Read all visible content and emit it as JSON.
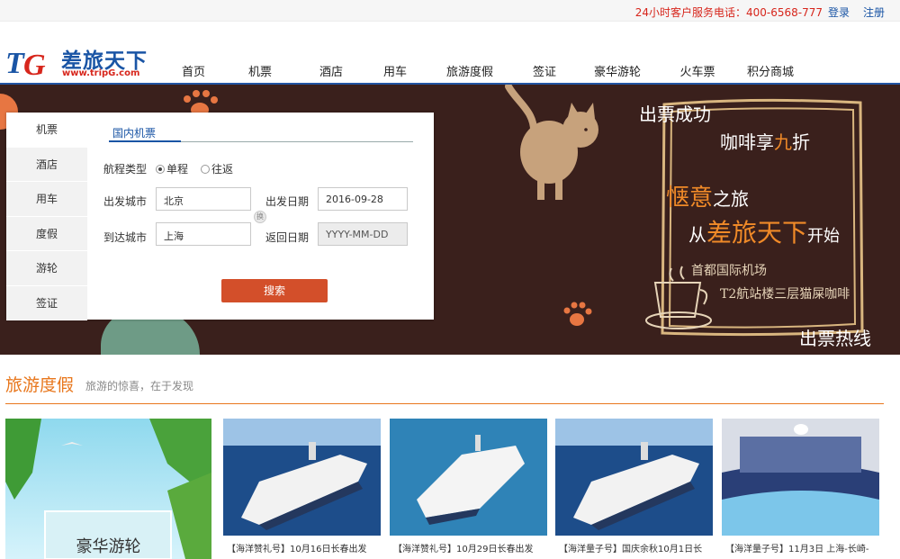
{
  "topbar": {
    "hotline": "24小时客户服务电话：400-6568-777",
    "login": "登录",
    "register": "注册"
  },
  "logo": {
    "mark": "TG",
    "brand": "差旅天下",
    "url": "www.tripG.com"
  },
  "nav": [
    "首页",
    "机票",
    "酒店",
    "用车",
    "旅游度假",
    "签证",
    "豪华游轮",
    "火车票",
    "积分商城"
  ],
  "booking": {
    "side_tabs": [
      "机票",
      "酒店",
      "用车",
      "度假",
      "游轮",
      "签证"
    ],
    "tab": "国内机票",
    "trip_type_label": "航程类型",
    "one_way": "单程",
    "round_trip": "往返",
    "depart_city_label": "出发城市",
    "depart_city": "北京",
    "arrive_city_label": "到达城市",
    "arrive_city": "上海",
    "swap": "换",
    "depart_date_label": "出发日期",
    "depart_date": "2016-09-28",
    "return_date_label": "返回日期",
    "return_date": "YYYY-MM-DD",
    "search": "搜索"
  },
  "promo": {
    "line1": "出票成功",
    "line2a": "咖啡享",
    "line2b": "九",
    "line2c": "折",
    "line3a": "惬意",
    "line3b": "之旅",
    "line4a": "从",
    "line4b": "差旅天下",
    "line4c": "开始",
    "line5": "首都国际机场",
    "line6": "T2航站楼三层猫屎咖啡",
    "line7": "出票热线"
  },
  "section": {
    "title": "旅游度假",
    "subtitle": "旅游的惊喜，在于发现"
  },
  "cards": [
    {
      "caption": "豪华游轮"
    },
    {
      "caption": "【海洋赞礼号】10月16日长春出发"
    },
    {
      "caption": "【海洋赞礼号】10月29日长春出发"
    },
    {
      "caption": "【海洋量子号】国庆余秋10月1日长"
    },
    {
      "caption": "【海洋量子号】11月3日 上海-长崎-"
    }
  ],
  "colors": {
    "brand_blue": "#1a55a5",
    "accent_red": "#d7261c",
    "section_orange": "#e8771d",
    "button": "#d34f2a",
    "banner_bg": "#3a201c"
  }
}
